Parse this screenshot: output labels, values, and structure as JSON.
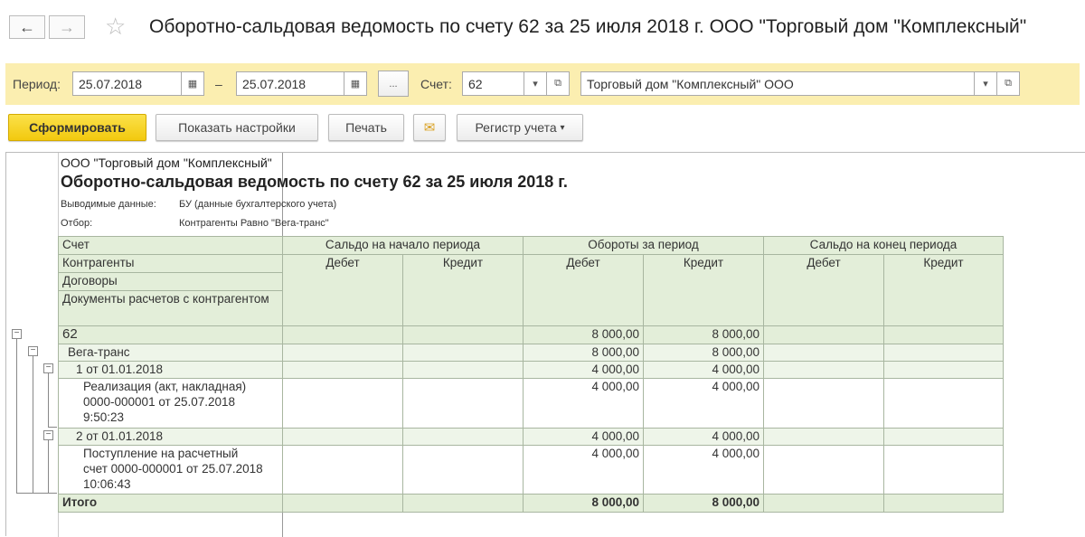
{
  "window": {
    "title": "Оборотно-сальдовая ведомость по счету 62 за 25 июля 2018 г. ООО \"Торговый дом \"Комплексный\"",
    "back": "←",
    "forward": "→",
    "star": "☆"
  },
  "filters": {
    "period_label": "Период:",
    "date_from": "25.07.2018",
    "dash": "–",
    "date_to": "25.07.2018",
    "more": "...",
    "account_label": "Счет:",
    "account": "62",
    "org": "Торговый дом \"Комплексный\" ООО"
  },
  "toolbar": {
    "generate": "Сформировать",
    "settings": "Показать настройки",
    "print": "Печать",
    "register": "Регистр учета"
  },
  "report": {
    "org": "ООО \"Торговый дом \"Комплексный\"",
    "title": "Оборотно-сальдовая ведомость по счету 62 за 25 июля 2018 г.",
    "output_label": "Выводимые данные:",
    "output_value": "БУ (данные бухгалтерского учета)",
    "filter_label": "Отбор:",
    "filter_value": "Контрагенты Равно \"Вега-транс\"",
    "headers": {
      "account": "Счет",
      "counterparties": "Контрагенты",
      "contracts": "Договоры",
      "documents": "Документы расчетов с контрагентом",
      "opening": "Сальдо на начало периода",
      "turnover": "Обороты за период",
      "closing": "Сальдо на конец периода",
      "debit": "Дебет",
      "credit": "Кредит"
    },
    "rows": [
      {
        "name": "62",
        "debit": "8 000,00",
        "credit": "8 000,00"
      },
      {
        "name": "Вега-транс",
        "debit": "8 000,00",
        "credit": "8 000,00"
      },
      {
        "name": "1 от 01.01.2018",
        "debit": "4 000,00",
        "credit": "4 000,00"
      },
      {
        "name": "Реализация (акт, накладная) 0000-000001 от 25.07.2018 9:50:23",
        "debit": "4 000,00",
        "credit": "4 000,00"
      },
      {
        "name": "2 от 01.01.2018",
        "debit": "4 000,00",
        "credit": "4 000,00"
      },
      {
        "name": "Поступление на расчетный счет 0000-000001 от 25.07.2018 10:06:43",
        "debit": "4 000,00",
        "credit": "4 000,00"
      }
    ],
    "total": {
      "name": "Итого",
      "debit": "8 000,00",
      "credit": "8 000,00"
    }
  }
}
